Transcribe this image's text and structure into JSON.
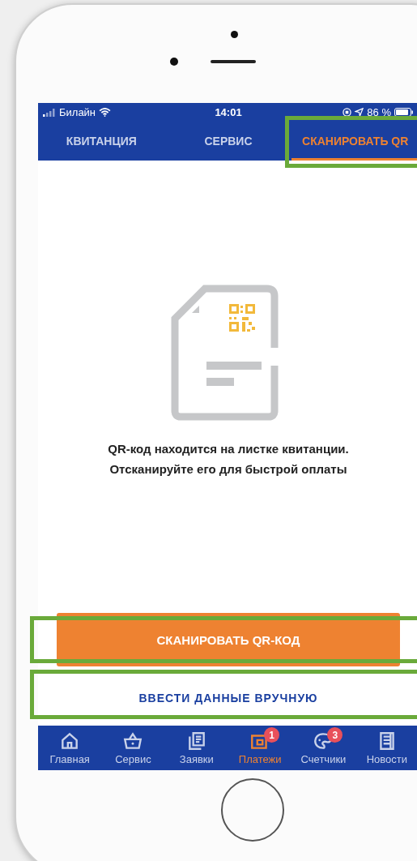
{
  "status_bar": {
    "carrier": "Билайн",
    "time": "14:01",
    "battery": "86 %"
  },
  "tabs": [
    {
      "label": "КВИТАНЦИЯ",
      "selected": false,
      "highlighted": false
    },
    {
      "label": "СЕРВИС",
      "selected": false,
      "highlighted": false
    },
    {
      "label": "СКАНИРОВАТЬ QR",
      "selected": true,
      "highlighted": true
    }
  ],
  "content": {
    "message": "QR-код находится на листке квитанции.\nОтсканируйте его для быстрой оплаты"
  },
  "buttons": [
    {
      "kind": "primary",
      "label": "СКАНИРОВАТЬ QR-КОД",
      "highlighted": true
    },
    {
      "kind": "secondary",
      "label": "ВВЕСТИ ДАННЫЕ ВРУЧНУЮ",
      "highlighted": true
    }
  ],
  "bottom_nav": [
    {
      "kind": "home",
      "label": "Главная",
      "selected": false
    },
    {
      "kind": "basket",
      "label": "Сервис",
      "selected": false
    },
    {
      "kind": "requests",
      "label": "Заявки",
      "selected": false
    },
    {
      "kind": "payments",
      "label": "Платежи",
      "selected": true,
      "badge": "1"
    },
    {
      "kind": "meters",
      "label": "Счетчики",
      "selected": false,
      "badge": "3"
    },
    {
      "kind": "news",
      "label": "Новости",
      "selected": false
    }
  ]
}
